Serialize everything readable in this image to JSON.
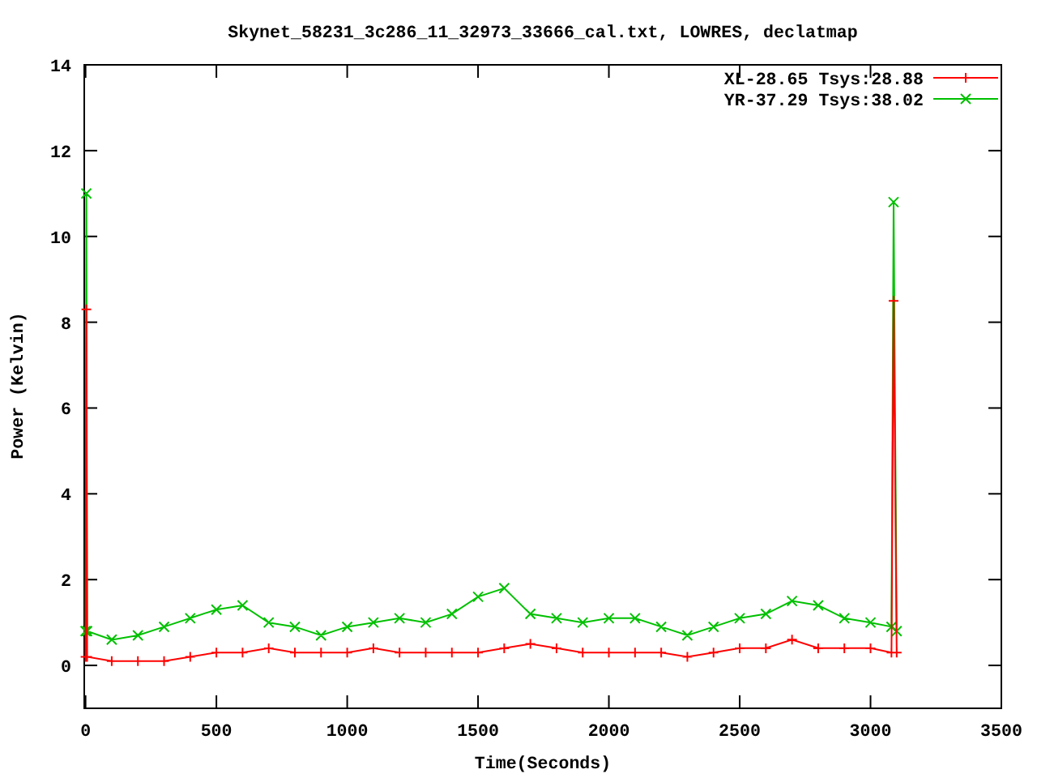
{
  "plot": {
    "chart_data": {
      "type": "line",
      "title": "Skynet_58231_3c286_11_32973_33666_cal.txt, LOWRES, declatmap",
      "xlabel": "Time(Seconds)",
      "ylabel": "Power (Kelvin)",
      "x": [
        0,
        3,
        6,
        100,
        200,
        300,
        400,
        500,
        600,
        700,
        800,
        900,
        1000,
        1100,
        1200,
        1300,
        1400,
        1500,
        1600,
        1700,
        1800,
        1900,
        2000,
        2100,
        2200,
        2300,
        2400,
        2500,
        2600,
        2700,
        2800,
        2900,
        3000,
        3080,
        3088,
        3100
      ],
      "series": [
        {
          "name": "XL-28.65 Tsys:28.88",
          "color": "#ff0000",
          "marker": "plus",
          "values": [
            0.2,
            8.3,
            0.2,
            0.1,
            0.1,
            0.1,
            0.2,
            0.3,
            0.3,
            0.4,
            0.3,
            0.3,
            0.3,
            0.4,
            0.3,
            0.3,
            0.3,
            0.3,
            0.4,
            0.5,
            0.4,
            0.3,
            0.3,
            0.3,
            0.3,
            0.2,
            0.3,
            0.4,
            0.4,
            0.6,
            0.4,
            0.4,
            0.4,
            0.3,
            8.5,
            0.3
          ]
        },
        {
          "name": "YR-37.29 Tsys:38.02",
          "color": "#00c000",
          "marker": "cross",
          "values": [
            0.8,
            11,
            0.8,
            0.6,
            0.7,
            0.9,
            1.1,
            1.3,
            1.4,
            1.0,
            0.9,
            0.7,
            0.9,
            1.0,
            1.1,
            1.0,
            1.2,
            1.6,
            1.8,
            1.2,
            1.1,
            1.0,
            1.1,
            1.1,
            0.9,
            0.7,
            0.9,
            1.1,
            1.2,
            1.5,
            1.4,
            1.1,
            1.0,
            0.9,
            10.8,
            0.8
          ]
        }
      ],
      "legend": true,
      "xlim": [
        -5,
        3500
      ],
      "ylim": [
        -1,
        14
      ],
      "xticks": [
        0,
        500,
        1000,
        1500,
        2000,
        2500,
        3000,
        3500
      ],
      "yticks": [
        0,
        2,
        4,
        6,
        8,
        10,
        12,
        14
      ]
    }
  }
}
